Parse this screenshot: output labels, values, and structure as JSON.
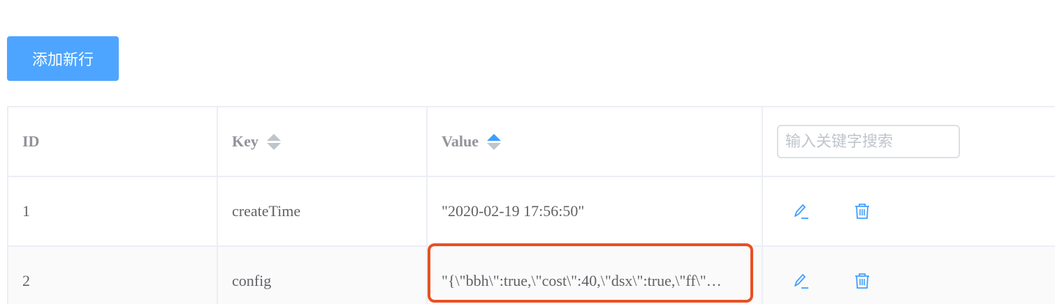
{
  "toolbar": {
    "add_label": "添加新行"
  },
  "table": {
    "headers": {
      "id": "ID",
      "key": "Key",
      "value": "Value"
    },
    "search": {
      "placeholder": "输入关键字搜索",
      "value": ""
    },
    "sort": {
      "key": "none",
      "value": "ascending"
    },
    "rows": [
      {
        "id": "1",
        "key": "createTime",
        "value": "\"2020-02-19 17:56:50\""
      },
      {
        "id": "2",
        "key": "config",
        "value": "\"{\\\"bbh\\\":true,\\\"cost\\\":40,\\\"dsx\\\":true,\\\"ff\\\"…"
      }
    ]
  },
  "icons": {
    "edit": "pencil-icon",
    "delete": "trash-icon"
  },
  "colors": {
    "primary": "#409eff",
    "highlight": "#ea4f21",
    "border": "#ebeef5",
    "text": "#606266",
    "header_text": "#909399"
  }
}
